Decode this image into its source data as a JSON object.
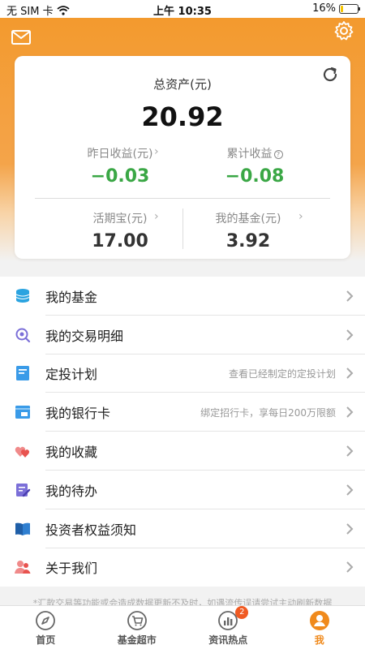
{
  "status_bar": {
    "carrier": "无 SIM 卡",
    "time": "上午 10:35",
    "battery": "16%",
    "battery_level": 0.16
  },
  "summary": {
    "total_label": "总资产(元)",
    "total_value": "20.92",
    "yesterday_label": "昨日收益(元)",
    "yesterday_value": "−0.03",
    "cumulative_label": "累计收益",
    "cumulative_value": "−0.08",
    "huoqibao_label": "活期宝(元)",
    "huoqibao_value": "17.00",
    "myfund_label": "我的基金(元)",
    "myfund_value": "3.92"
  },
  "menu": {
    "items": [
      {
        "title": "我的基金",
        "hint": ""
      },
      {
        "title": "我的交易明细",
        "hint": ""
      },
      {
        "title": "定投计划",
        "hint": "查看已经制定的定投计划"
      },
      {
        "title": "我的银行卡",
        "hint": "绑定招行卡，享每日200万限额"
      },
      {
        "title": "我的收藏",
        "hint": ""
      },
      {
        "title": "我的待办",
        "hint": ""
      },
      {
        "title": "投资者权益须知",
        "hint": ""
      },
      {
        "title": "关于我们",
        "hint": ""
      }
    ]
  },
  "disclaimer": "*汇款交易等功能或会造成数据更新不及时，如遇流传误请尝试主动刷新数据",
  "tabbar": {
    "tabs": [
      {
        "label": "首页",
        "icon": "compass-icon"
      },
      {
        "label": "基金超市",
        "icon": "cart-icon"
      },
      {
        "label": "资讯热点",
        "icon": "chart-icon",
        "badge": "2"
      },
      {
        "label": "我",
        "icon": "person-icon"
      }
    ]
  },
  "colors": {
    "accent": "#f08a1c",
    "positive_loss": "#3aa745",
    "badge": "#f05a22"
  }
}
